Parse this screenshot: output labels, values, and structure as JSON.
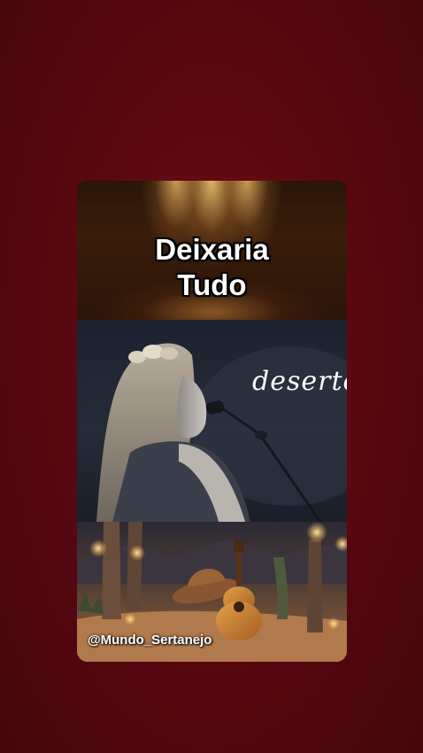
{
  "title": {
    "line1": "Deixaria",
    "line2": "Tudo"
  },
  "overlay_word": "deserto",
  "handle": "@Mundo_Sertanejo",
  "colors": {
    "background": "#5a0811",
    "title_text": "#ffffff",
    "title_outline": "#000000"
  }
}
